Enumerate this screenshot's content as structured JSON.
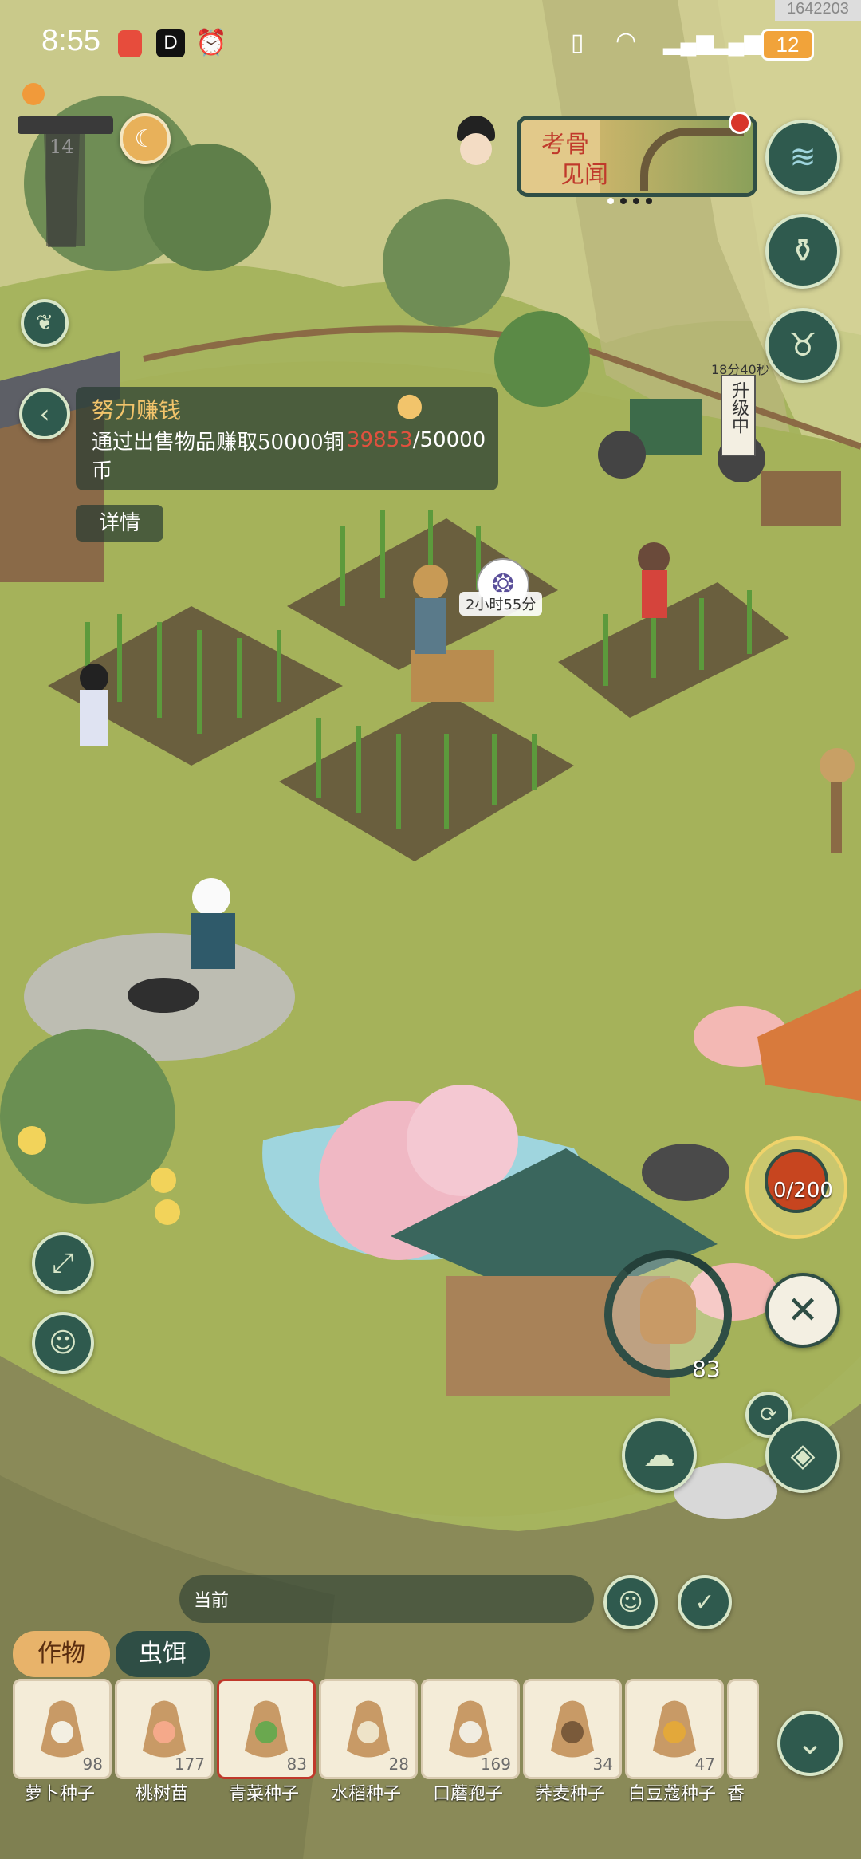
{
  "status_bar": {
    "time": "8:55",
    "battery": "12",
    "watermark": "1642203"
  },
  "hud": {
    "level": "14",
    "exhibit_title_line1": "考骨",
    "exhibit_title_line2": "见闻",
    "upgrade_timer": "18分40秒",
    "upgrade_label": "升级中"
  },
  "quest": {
    "title": "努力赚钱",
    "description": "通过出售物品赚取50000铜币",
    "progress_current": "39853",
    "progress_total": "/50000",
    "detail_label": "详情"
  },
  "crop_timer": "2小时55分",
  "energy": "0/200",
  "selected_count": "83",
  "current_label": "当前",
  "tabs": {
    "crops": "作物",
    "bait": "虫饵"
  },
  "items": [
    {
      "name": "萝卜种子",
      "count": "98"
    },
    {
      "name": "桃树苗",
      "count": "177"
    },
    {
      "name": "青菜种子",
      "count": "83"
    },
    {
      "name": "水稻种子",
      "count": "28"
    },
    {
      "name": "口蘑孢子",
      "count": "169"
    },
    {
      "name": "荞麦种子",
      "count": "34"
    },
    {
      "name": "白豆蔻种子",
      "count": "47"
    },
    {
      "name": "香",
      "count": ""
    }
  ],
  "colors": {
    "button_bg": "#2f5a4e",
    "tab_active": "#e8b36a",
    "quest_title": "#f2c46b",
    "progress_current": "#e0513e"
  }
}
